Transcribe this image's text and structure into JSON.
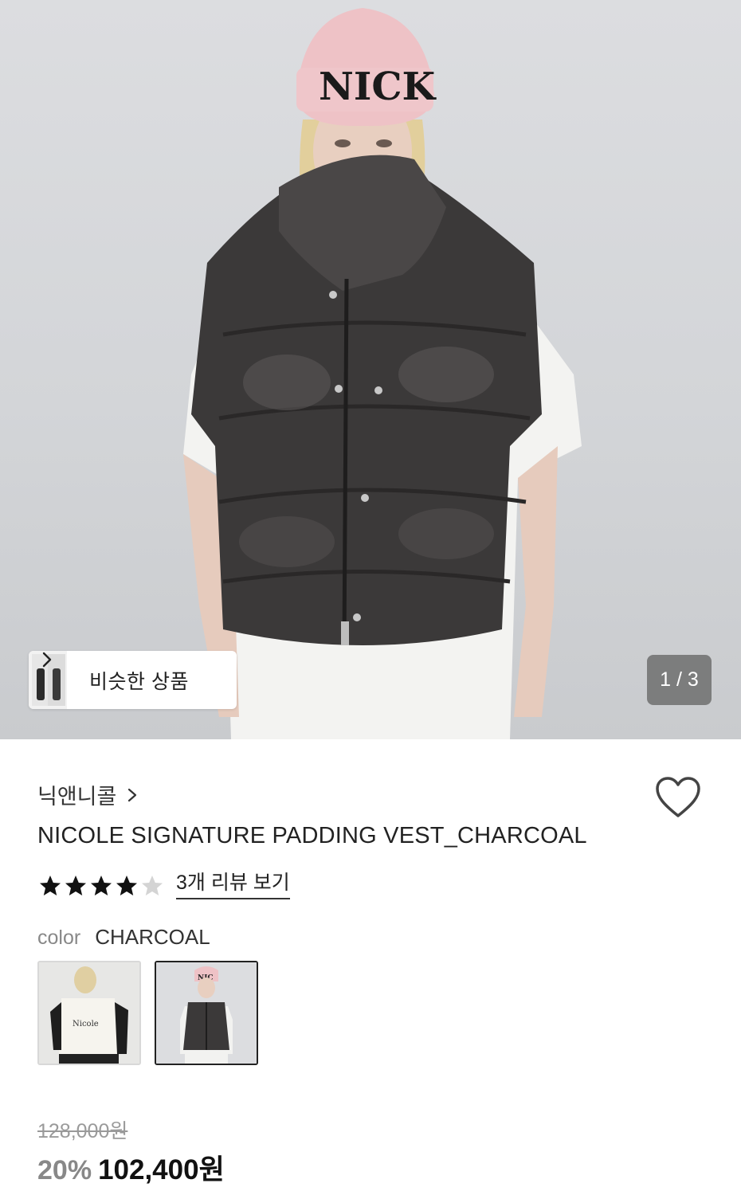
{
  "gallery": {
    "similar_label": "비슷한 상품",
    "counter": "1 / 3",
    "hat_text": "NICK"
  },
  "product": {
    "brand": "닉앤니콜",
    "title": "NICOLE SIGNATURE PADDING VEST_CHARCOAL",
    "rating": 4,
    "rating_max": 5,
    "review_link": "3개 리뷰 보기",
    "color_label": "color",
    "color_value": "CHARCOAL",
    "swatches": [
      {
        "name": "white",
        "selected": false,
        "print": "Nicole"
      },
      {
        "name": "charcoal",
        "selected": true,
        "print": "NIC"
      }
    ],
    "original_price": "128,000원",
    "discount": "20%",
    "sale_price": "102,400원"
  },
  "colors": {
    "text_primary": "#111111",
    "text_muted": "#888888",
    "counter_bg": "#6e6e6e",
    "vest": "#3a3838"
  },
  "icons": {
    "chip_chevron": "chevron-right-icon",
    "brand_chevron": "chevron-right-icon",
    "wishlist": "heart-outline-icon",
    "rating": "star-icon"
  }
}
